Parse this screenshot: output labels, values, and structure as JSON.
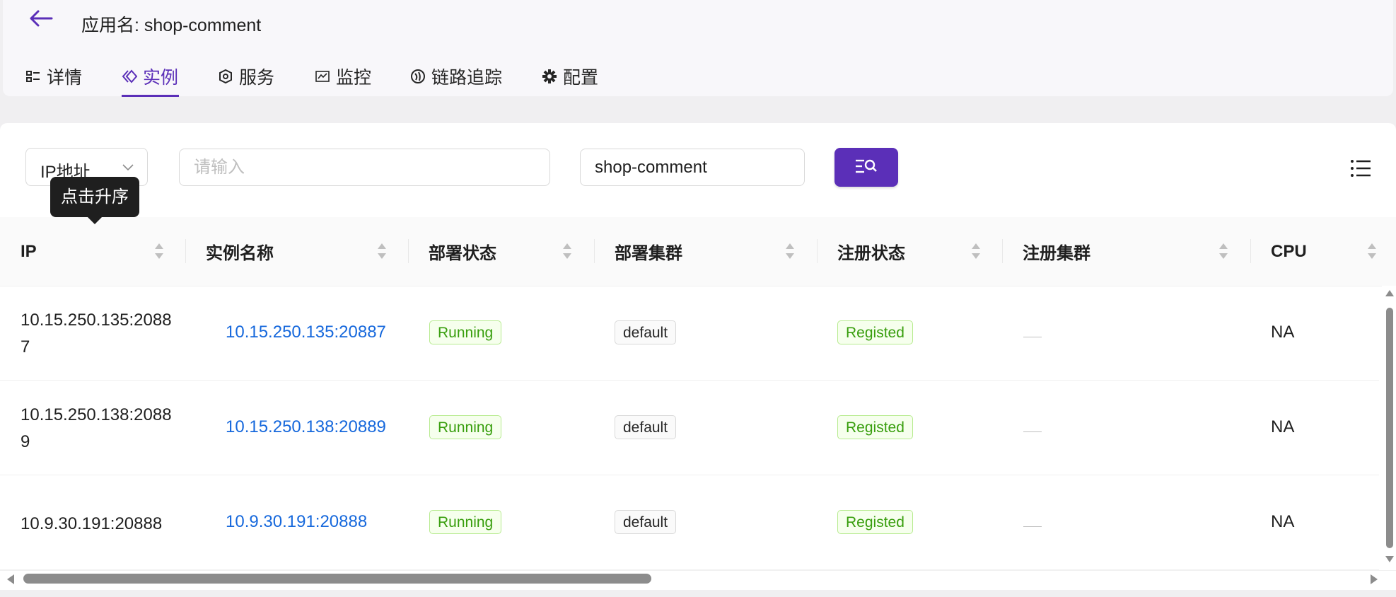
{
  "header": {
    "app_title": "应用名: shop-comment",
    "colors": {
      "accent": "#5b2fb8",
      "link": "#1668dc"
    }
  },
  "tabs": [
    {
      "label": "详情",
      "icon": "detail-list-icon"
    },
    {
      "label": "实例",
      "icon": "instance-diamond-icon",
      "active": true
    },
    {
      "label": "服务",
      "icon": "service-shield-icon"
    },
    {
      "label": "监控",
      "icon": "monitor-chart-icon"
    },
    {
      "label": "链路追踪",
      "icon": "trace-icon"
    },
    {
      "label": "配置",
      "icon": "gear-icon"
    }
  ],
  "filters": {
    "field_select": "IP地址",
    "keyword_placeholder": "请输入",
    "app_value": "shop-comment"
  },
  "tooltip": "点击升序",
  "table": {
    "columns": [
      "IP",
      "实例名称",
      "部署状态",
      "部署集群",
      "注册状态",
      "注册集群",
      "CPU"
    ],
    "rows": [
      {
        "ip_line1": "10.15.250.135:2088",
        "ip_line2": "7",
        "name": "10.15.250.135:20887",
        "deploy_status": "Running",
        "deploy_cluster": "default",
        "register_status": "Registed",
        "register_cluster": "",
        "cpu": "NA"
      },
      {
        "ip_line1": "10.15.250.138:2088",
        "ip_line2": "9",
        "name": "10.15.250.138:20889",
        "deploy_status": "Running",
        "deploy_cluster": "default",
        "register_status": "Registed",
        "register_cluster": "",
        "cpu": "NA"
      },
      {
        "ip_line1": "10.9.30.191:20888",
        "ip_line2": "",
        "name": "10.9.30.191:20888",
        "deploy_status": "Running",
        "deploy_cluster": "default",
        "register_status": "Registed",
        "register_cluster": "",
        "cpu": "NA"
      }
    ]
  }
}
